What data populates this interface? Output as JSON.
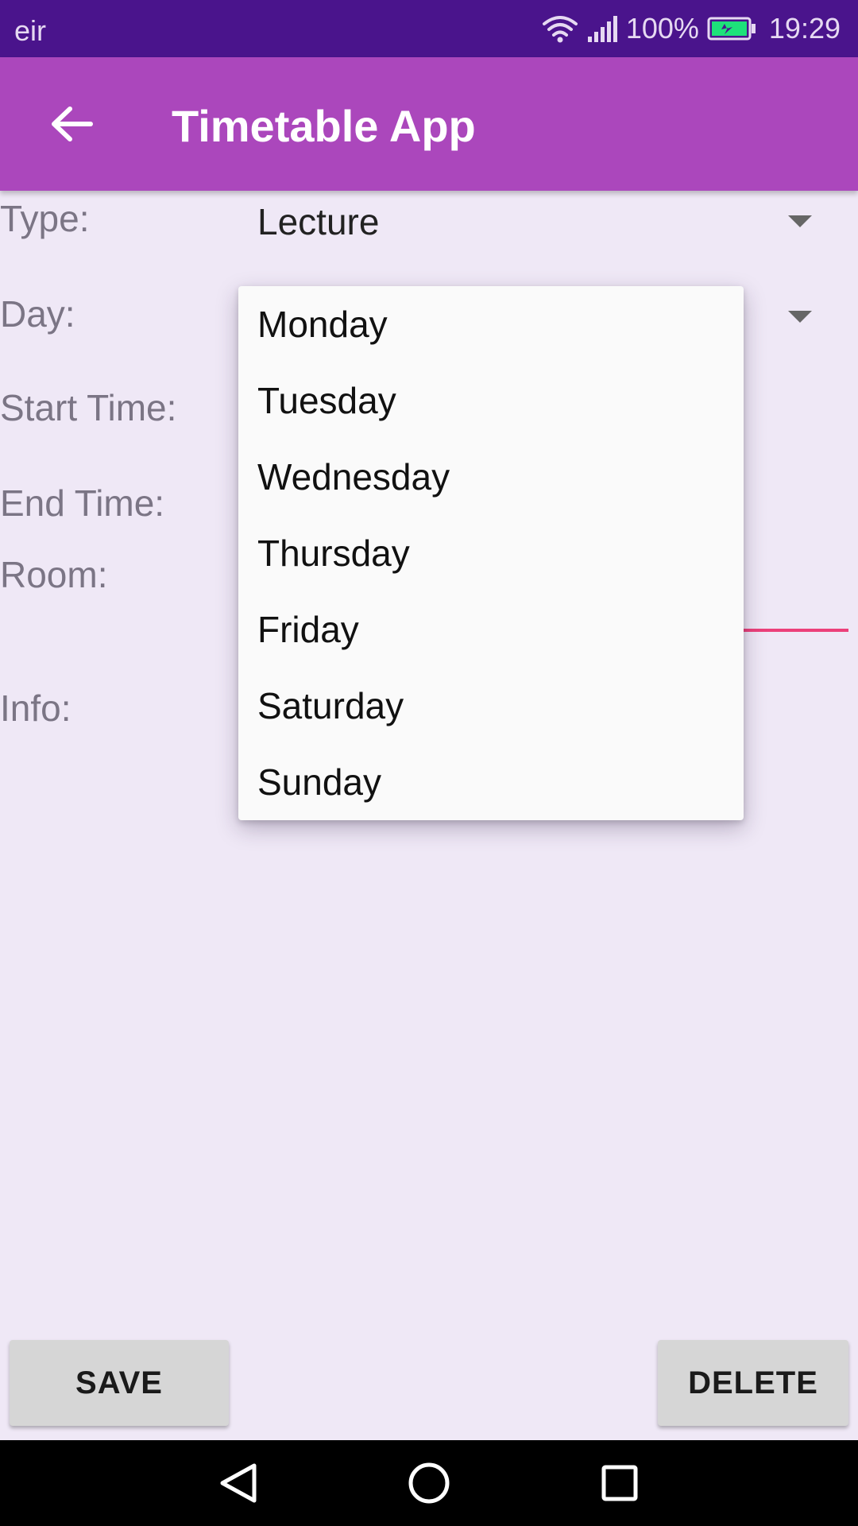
{
  "status_bar": {
    "carrier": "eir",
    "battery_percent": "100%",
    "time": "19:29",
    "icons": [
      "wifi-icon",
      "signal-icon",
      "battery-charging-icon"
    ],
    "battery_color": "#1DE27A"
  },
  "app_bar": {
    "title": "Timetable App",
    "back_icon": "arrow-left-icon",
    "color": "#AB47BC"
  },
  "form": {
    "type_label": "Type:",
    "type_value": "Lecture",
    "day_label": "Day:",
    "start_time_label": "Start Time:",
    "end_time_label": "End Time:",
    "room_label": "Room:",
    "info_label": "Info:",
    "accent_color": "#EC407A"
  },
  "day_dropdown": {
    "options": [
      "Monday",
      "Tuesday",
      "Wednesday",
      "Thursday",
      "Friday",
      "Saturday",
      "Sunday"
    ]
  },
  "actions": {
    "save_label": "SAVE",
    "delete_label": "DELETE"
  },
  "nav_bar": {
    "icons": [
      "nav-back-icon",
      "nav-home-icon",
      "nav-recents-icon"
    ]
  }
}
